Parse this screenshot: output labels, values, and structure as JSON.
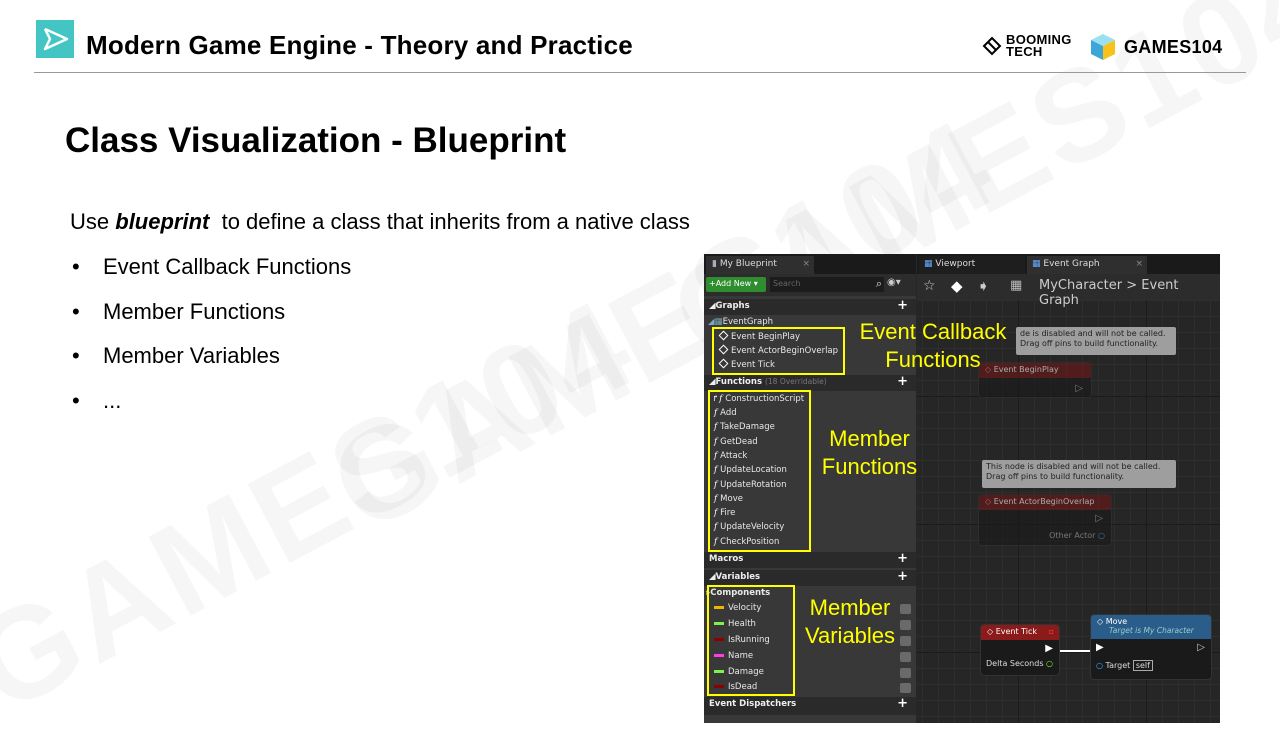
{
  "header": {
    "title": "Modern Game Engine - Theory and Practice",
    "brand_booming_1": "BOOMING",
    "brand_booming_2": "TECH",
    "brand_games": "GAMES104"
  },
  "slide": {
    "title": "Class Visualization - Blueprint",
    "intro_prefix": "Use",
    "intro_emph": "blueprint",
    "intro_suffix": "to define a class that inherits from a native class",
    "bullets": [
      "Event Callback Functions",
      "Member Functions",
      "Member Variables",
      "..."
    ],
    "bullet_symbol": "•"
  },
  "watermark": {
    "text": "GAMES104"
  },
  "editor": {
    "panel_tab": "My Blueprint",
    "add_new": "Add New",
    "search_placeholder": "Search",
    "graphs_header": "Graphs",
    "event_graph": "EventGraph",
    "events": [
      "Event BeginPlay",
      "Event ActorBeginOverlap",
      "Event Tick"
    ],
    "functions_header": "Functions",
    "functions_overridable": "(18 Overridable)",
    "functions": [
      "ConstructionScript",
      "Add",
      "TakeDamage",
      "GetDead",
      "Attack",
      "UpdateLocation",
      "UpdateRotation",
      "Move",
      "Fire",
      "UpdateVelocity",
      "CheckPosition"
    ],
    "macros_header": "Macros",
    "variables_header": "Variables",
    "components_header": "Components",
    "variables": [
      {
        "name": "Velocity",
        "color": "#f0b400"
      },
      {
        "name": "Health",
        "color": "#7cf24a"
      },
      {
        "name": "IsRunning",
        "color": "#8b0000"
      },
      {
        "name": "Name",
        "color": "#ff3de0"
      },
      {
        "name": "Damage",
        "color": "#7cf24a"
      },
      {
        "name": "IsDead",
        "color": "#8b0000"
      }
    ],
    "dispatchers_header": "Event Dispatchers",
    "tab_viewport": "Viewport",
    "tab_event_graph": "Event Graph",
    "breadcrumb_class": "MyCharacter",
    "breadcrumb_sep": ">",
    "breadcrumb_graph": "Event Graph",
    "comment_line1": "This node is disabled and will not be called.",
    "comment_line2": "Drag off pins to build functionality.",
    "comment_line1_partial": "de is disabled and will not be called.",
    "node_begin_play": "Event BeginPlay",
    "node_overlap": "Event ActorBeginOverlap",
    "pin_other_actor": "Other Actor",
    "node_tick": "Event Tick",
    "pin_delta_seconds": "Delta Seconds",
    "node_move": "Move",
    "node_move_sub": "Target is My Character",
    "pin_target": "Target",
    "pin_self": "self"
  },
  "annotations": {
    "event_callback_1": "Event Callback",
    "event_callback_2": "Functions",
    "member_functions_1": "Member",
    "member_functions_2": "Functions",
    "member_variables_1": "Member",
    "member_variables_2": "Variables"
  },
  "colors": {
    "accent": "#43c6c3",
    "annotation": "#ffff00",
    "event_node": "#8b1a1a",
    "function_node": "#2a5d8a"
  }
}
